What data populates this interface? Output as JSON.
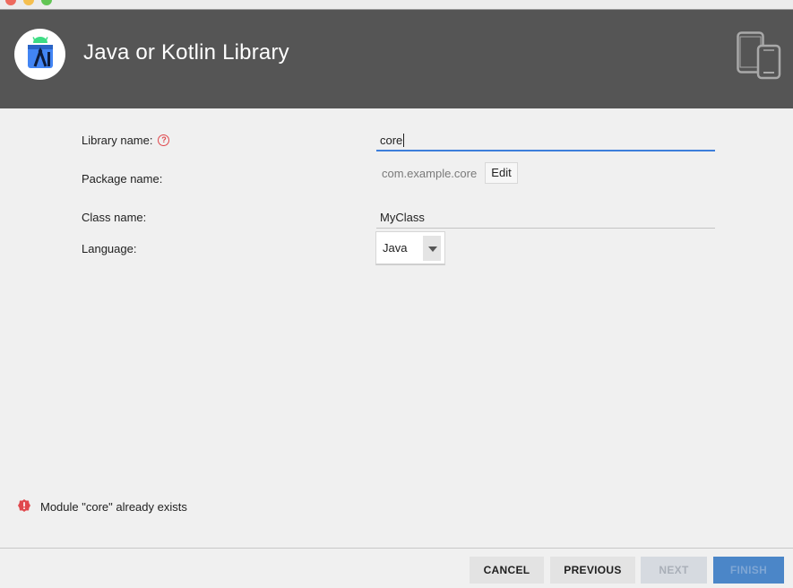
{
  "header": {
    "title": "Java or Kotlin Library"
  },
  "form": {
    "library_name": {
      "label": "Library name:",
      "value": "core"
    },
    "package_name": {
      "label": "Package name:",
      "value": "com.example.core",
      "edit_label": "Edit"
    },
    "class_name": {
      "label": "Class name:",
      "value": "MyClass"
    },
    "language": {
      "label": "Language:",
      "selected": "Java"
    }
  },
  "error": {
    "message": "Module \"core\" already exists"
  },
  "footer": {
    "cancel": "CANCEL",
    "previous": "PREVIOUS",
    "next": "NEXT",
    "finish": "FINISH"
  },
  "colors": {
    "header_bg": "#555555",
    "accent": "#3d7edb",
    "error": "#e0474c",
    "finish_bg": "#4b86c8"
  },
  "icons": {
    "logo": "android-studio-icon",
    "device": "phone-tablet-icon",
    "help": "help-icon",
    "error": "error-icon",
    "dropdown": "chevron-down-icon"
  }
}
